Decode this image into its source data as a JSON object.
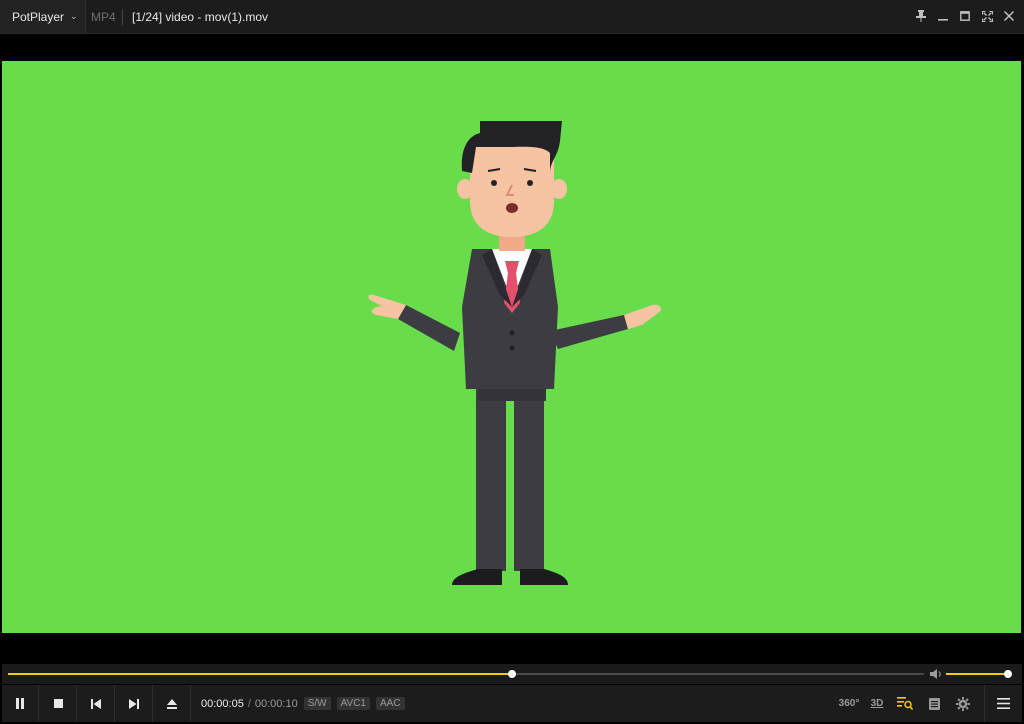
{
  "app": {
    "name": "PotPlayer",
    "format": "MP4",
    "title": "[1/24] video - mov(1).mov"
  },
  "window_buttons": [
    "pin-icon",
    "minimize-icon",
    "maximize-icon",
    "fullscreen-icon",
    "close-icon"
  ],
  "playback": {
    "current_time": "00:00:05",
    "separator": "/",
    "duration": "00:00:10",
    "progress": 0.55,
    "volume": 1.0
  },
  "codec_tags": {
    "decoder": "S/W",
    "video": "AVC1",
    "audio": "AAC"
  },
  "right_buttons": {
    "vr_label": "360°",
    "three_d_label": "3D"
  },
  "colors": {
    "accent": "#f3c81a",
    "video_background": "#68dc4b"
  }
}
